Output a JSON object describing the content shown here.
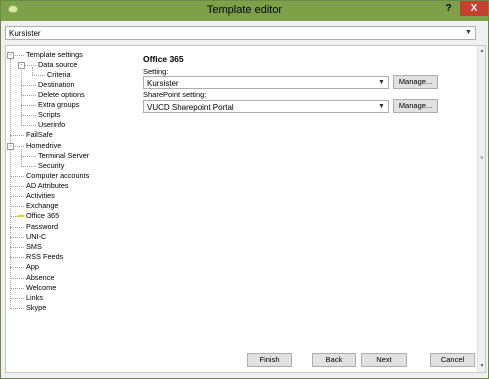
{
  "window": {
    "title": "Template editor",
    "help_label": "?",
    "close_label": "X"
  },
  "template_select": {
    "value": "Kursister"
  },
  "tree": {
    "items": [
      {
        "label": "Template settings",
        "box": "-"
      },
      {
        "label": "Data source",
        "box": "-"
      },
      {
        "label": "Criteria"
      },
      {
        "label": "Destination"
      },
      {
        "label": "Delete options"
      },
      {
        "label": "Extra groups"
      },
      {
        "label": "Scripts"
      },
      {
        "label": "Userinfo"
      },
      {
        "label": "FailSafe"
      },
      {
        "label": "Homedrive",
        "box": "-"
      },
      {
        "label": "Terminal Server"
      },
      {
        "label": "Security"
      },
      {
        "label": "Computer accounts"
      },
      {
        "label": "AD Attributes"
      },
      {
        "label": "Activities"
      },
      {
        "label": "Exchange"
      },
      {
        "label": "Office 365",
        "selected": true
      },
      {
        "label": "Password"
      },
      {
        "label": "UNI-C"
      },
      {
        "label": "SMS"
      },
      {
        "label": "RSS Feeds"
      },
      {
        "label": "App"
      },
      {
        "label": "Absence"
      },
      {
        "label": "Welcome"
      },
      {
        "label": "Links"
      },
      {
        "label": "Skype"
      }
    ]
  },
  "panel": {
    "title": "Office 365",
    "setting_label": "Setting:",
    "setting_value": "Kursister",
    "sharepoint_label": "SharePoint setting:",
    "sharepoint_value": "VUCD Sharepoint Portal",
    "manage_label": "Manage..."
  },
  "buttons": {
    "finish": "Finish",
    "back": "Back",
    "next": "Next",
    "cancel": "Cancel"
  },
  "colors": {
    "titlebar": "#7ea148",
    "close_button": "#c7402e",
    "selected_marker": "#e8d000"
  }
}
